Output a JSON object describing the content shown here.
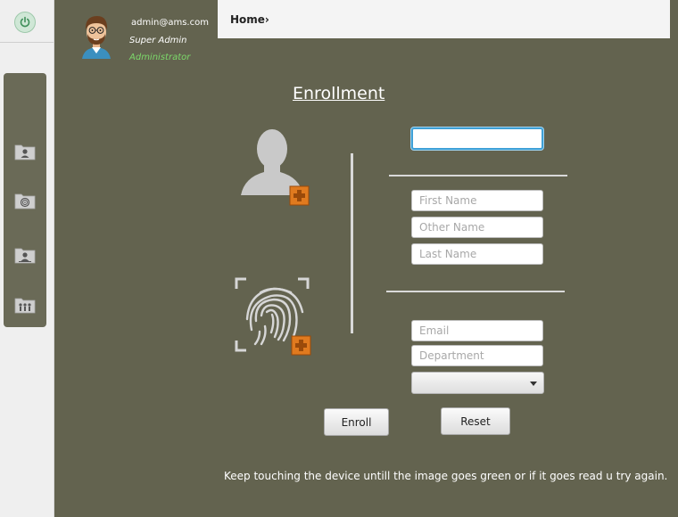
{
  "sidebar": {
    "power_icon": "power-icon",
    "items": [
      {
        "icon": "user-folder-icon"
      },
      {
        "icon": "fingerprint-folder-icon"
      },
      {
        "icon": "user-folder-alt-icon"
      },
      {
        "icon": "group-folder-icon"
      }
    ]
  },
  "profile": {
    "email": "admin@ams.com",
    "role": "Super Admin",
    "title": "Administrator"
  },
  "topbar": {
    "breadcrumb": "Home›"
  },
  "form": {
    "title": "Enrollment",
    "id_field": {
      "value": "",
      "placeholder": ""
    },
    "first_name": {
      "value": "",
      "placeholder": "First Name"
    },
    "other_name": {
      "value": "",
      "placeholder": "Other Name"
    },
    "last_name": {
      "value": "",
      "placeholder": "Last Name"
    },
    "email": {
      "value": "",
      "placeholder": "Email"
    },
    "department": {
      "value": "",
      "placeholder": "Department"
    },
    "select": {
      "value": ""
    },
    "enroll_label": "Enroll",
    "reset_label": "Reset",
    "hint": "Keep touching the device untill the image goes green or if it goes read u try again."
  },
  "colors": {
    "background": "#63634f",
    "accent_orange": "#e07a1f",
    "focus_blue": "#3fa0d6",
    "administrator_green": "#7cd86a"
  }
}
